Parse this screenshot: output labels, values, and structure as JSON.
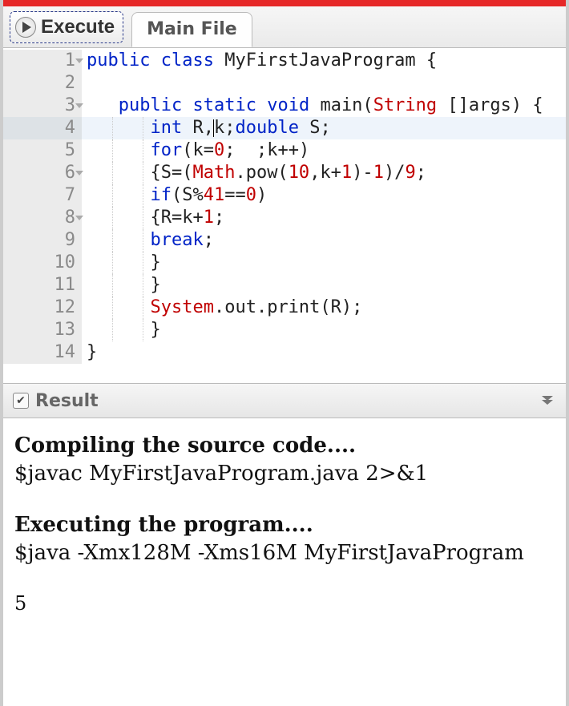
{
  "toolbar": {
    "execute_label": "Execute"
  },
  "tabs": {
    "main_label": "Main File"
  },
  "code": {
    "lines": [
      {
        "n": "1",
        "fold": true,
        "cursor": false,
        "indent": 0,
        "tokens": [
          [
            "kw",
            "public"
          ],
          [
            "plain",
            " "
          ],
          [
            "kw",
            "class"
          ],
          [
            "plain",
            " MyFirstJavaProgram {"
          ]
        ]
      },
      {
        "n": "2",
        "fold": false,
        "cursor": false,
        "indent": 0,
        "tokens": [
          [
            "plain",
            ""
          ]
        ]
      },
      {
        "n": "3",
        "fold": true,
        "cursor": false,
        "indent": 0,
        "tokens": [
          [
            "plain",
            "   "
          ],
          [
            "kw",
            "public"
          ],
          [
            "plain",
            " "
          ],
          [
            "kw",
            "static"
          ],
          [
            "plain",
            " "
          ],
          [
            "typekw",
            "void"
          ],
          [
            "plain",
            " main("
          ],
          [
            "cls",
            "String"
          ],
          [
            "plain",
            " []args) {"
          ]
        ]
      },
      {
        "n": "4",
        "fold": false,
        "cursor": true,
        "indent": 2,
        "tokens": [
          [
            "plain",
            "      "
          ],
          [
            "typekw",
            "int"
          ],
          [
            "plain",
            " R,"
          ],
          [
            "__cursor__",
            ""
          ],
          [
            "plain",
            "k;"
          ],
          [
            "typekw",
            "double"
          ],
          [
            "plain",
            " S;"
          ]
        ]
      },
      {
        "n": "5",
        "fold": false,
        "cursor": false,
        "indent": 2,
        "tokens": [
          [
            "plain",
            "      "
          ],
          [
            "kw",
            "for"
          ],
          [
            "plain",
            "(k="
          ],
          [
            "num",
            "0"
          ],
          [
            "plain",
            ";  ;k++)"
          ]
        ]
      },
      {
        "n": "6",
        "fold": true,
        "cursor": false,
        "indent": 2,
        "tokens": [
          [
            "plain",
            "      {S=("
          ],
          [
            "cls",
            "Math"
          ],
          [
            "plain",
            ".pow("
          ],
          [
            "num",
            "10"
          ],
          [
            "plain",
            ",k+"
          ],
          [
            "num",
            "1"
          ],
          [
            "plain",
            ")-"
          ],
          [
            "num",
            "1"
          ],
          [
            "plain",
            ")/"
          ],
          [
            "num",
            "9"
          ],
          [
            "plain",
            ";"
          ]
        ]
      },
      {
        "n": "7",
        "fold": false,
        "cursor": false,
        "indent": 2,
        "tokens": [
          [
            "plain",
            "      "
          ],
          [
            "kw",
            "if"
          ],
          [
            "plain",
            "(S%"
          ],
          [
            "num",
            "41"
          ],
          [
            "plain",
            "=="
          ],
          [
            "num",
            "0"
          ],
          [
            "plain",
            ")"
          ]
        ]
      },
      {
        "n": "8",
        "fold": true,
        "cursor": false,
        "indent": 2,
        "tokens": [
          [
            "plain",
            "      {R=k+"
          ],
          [
            "num",
            "1"
          ],
          [
            "plain",
            ";"
          ]
        ]
      },
      {
        "n": "9",
        "fold": false,
        "cursor": false,
        "indent": 2,
        "tokens": [
          [
            "plain",
            "      "
          ],
          [
            "kw",
            "break"
          ],
          [
            "plain",
            ";"
          ]
        ]
      },
      {
        "n": "10",
        "fold": false,
        "cursor": false,
        "indent": 2,
        "tokens": [
          [
            "plain",
            "      }"
          ]
        ]
      },
      {
        "n": "11",
        "fold": false,
        "cursor": false,
        "indent": 2,
        "tokens": [
          [
            "plain",
            "      }"
          ]
        ]
      },
      {
        "n": "12",
        "fold": false,
        "cursor": false,
        "indent": 2,
        "tokens": [
          [
            "plain",
            "      "
          ],
          [
            "cls",
            "System"
          ],
          [
            "plain",
            ".out.print(R);"
          ]
        ]
      },
      {
        "n": "13",
        "fold": false,
        "cursor": false,
        "indent": 2,
        "tokens": [
          [
            "plain",
            "      }"
          ]
        ]
      },
      {
        "n": "14",
        "fold": false,
        "cursor": false,
        "indent": 0,
        "tokens": [
          [
            "plain",
            "}"
          ]
        ]
      }
    ]
  },
  "result": {
    "title": "Result",
    "compile_heading": "Compiling the source code....",
    "compile_cmd": "$javac MyFirstJavaProgram.java 2>&1",
    "execute_heading": "Executing the program....",
    "execute_cmd": "$java -Xmx128M -Xms16M MyFirstJavaProgram",
    "output": "5"
  }
}
